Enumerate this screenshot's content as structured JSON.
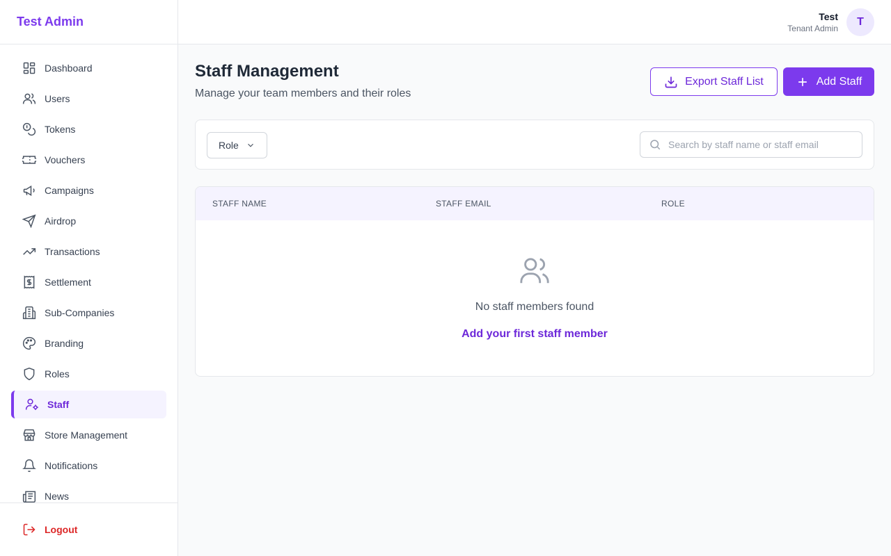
{
  "brand": {
    "title": "Test Admin"
  },
  "sidebar": {
    "items": [
      {
        "label": "Dashboard",
        "icon": "dashboard-icon"
      },
      {
        "label": "Users",
        "icon": "users-icon"
      },
      {
        "label": "Tokens",
        "icon": "coins-icon"
      },
      {
        "label": "Vouchers",
        "icon": "ticket-icon"
      },
      {
        "label": "Campaigns",
        "icon": "megaphone-icon"
      },
      {
        "label": "Airdrop",
        "icon": "send-icon"
      },
      {
        "label": "Transactions",
        "icon": "trending-up-icon"
      },
      {
        "label": "Settlement",
        "icon": "receipt-dollar-icon"
      },
      {
        "label": "Sub-Companies",
        "icon": "building-icon"
      },
      {
        "label": "Branding",
        "icon": "palette-icon"
      },
      {
        "label": "Roles",
        "icon": "shield-icon"
      },
      {
        "label": "Staff",
        "icon": "user-cog-icon",
        "active": true
      },
      {
        "label": "Store Management",
        "icon": "store-icon"
      },
      {
        "label": "Notifications",
        "icon": "bell-icon"
      },
      {
        "label": "News",
        "icon": "newspaper-icon"
      }
    ],
    "logout_label": "Logout"
  },
  "header": {
    "user_name": "Test",
    "user_role": "Tenant Admin",
    "avatar_initial": "T"
  },
  "page": {
    "title": "Staff Management",
    "subtitle": "Manage your team members and their roles",
    "export_label": "Export Staff List",
    "add_label": "Add Staff"
  },
  "filters": {
    "role_label": "Role",
    "search_placeholder": "Search by staff name or staff email"
  },
  "table": {
    "columns": [
      "STAFF NAME",
      "STAFF EMAIL",
      "ROLE"
    ],
    "empty_text": "No staff members found",
    "empty_link": "Add your first staff member"
  },
  "colors": {
    "accent": "#7c3aed",
    "active_bg": "#f5f3ff",
    "danger": "#dc2626"
  }
}
